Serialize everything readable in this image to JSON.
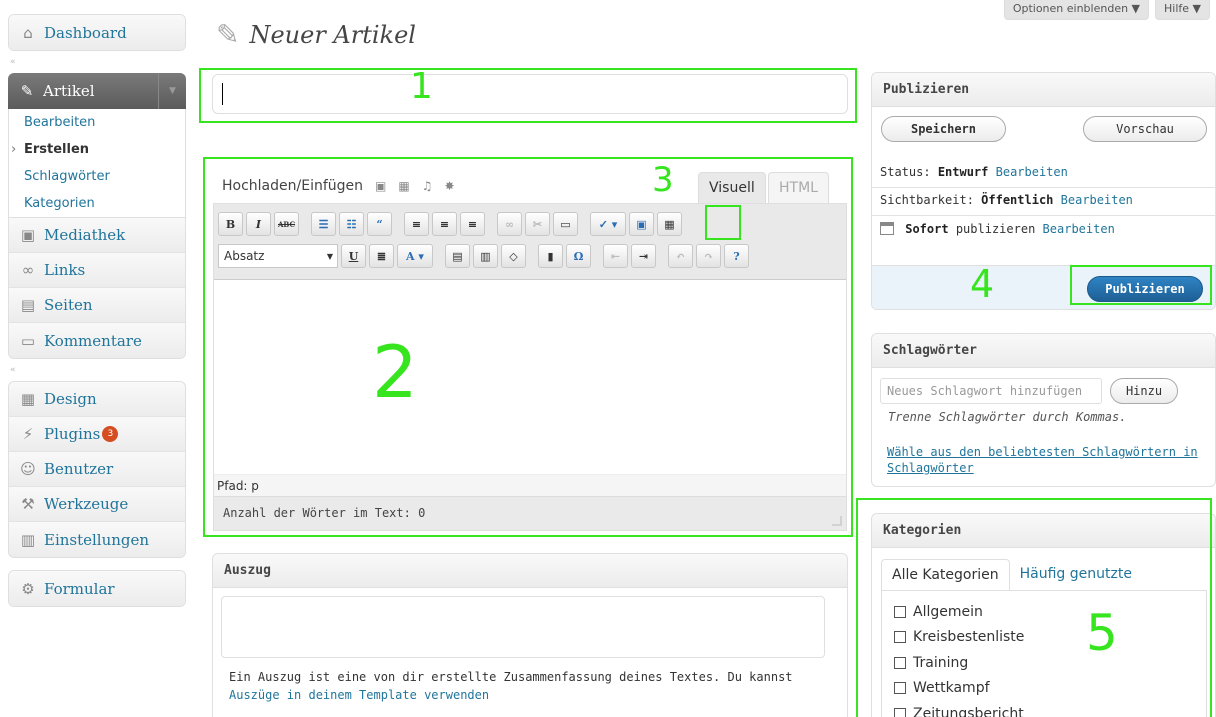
{
  "top_tabs": [
    "Optionen einblenden ▼",
    "Hilfe ▼"
  ],
  "page": {
    "title": "Neuer Artikel"
  },
  "sidebar": {
    "dashboard": "Dashboard",
    "artikel": {
      "label": "Artikel",
      "items": [
        "Bearbeiten",
        "Erstellen",
        "Schlagwörter",
        "Kategorien"
      ]
    },
    "group1": [
      "Mediathek",
      "Links",
      "Seiten",
      "Kommentare"
    ],
    "group2": [
      "Design",
      "Plugins",
      "Benutzer",
      "Werkzeuge",
      "Einstellungen"
    ],
    "plugins_badge": "3",
    "formular": "Formular"
  },
  "editor": {
    "upload_label": "Hochladen/Einfügen",
    "tab_visual": "Visuell",
    "tab_html": "HTML",
    "format_select": "Absatz",
    "path": "Pfad: p",
    "wordcount": "Anzahl der Wörter im Text: 0"
  },
  "excerpt": {
    "title": "Auszug",
    "description": "Ein Auszug ist eine von dir erstellte Zusammenfassung deines Textes. Du kannst",
    "link": "Auszüge in deinem Template verwenden"
  },
  "publish": {
    "title": "Publizieren",
    "save": "Speichern",
    "preview": "Vorschau",
    "status_label": "Status:",
    "status_value": "Entwurf",
    "visibility_label": "Sichtbarkeit:",
    "visibility_value": "Öffentlich",
    "edit": "Bearbeiten",
    "schedule_value": "Sofort",
    "schedule_label": "publizieren",
    "publish_button": "Publizieren"
  },
  "tags": {
    "title": "Schlagwörter",
    "placeholder": "Neues Schlagwort hinzufügen",
    "add": "Hinzu",
    "hint": "Trenne Schlagwörter durch Kommas.",
    "popular_link": "Wähle aus den beliebtesten Schlagwörtern in Schlagwörter"
  },
  "categories": {
    "title": "Kategorien",
    "tab_all": "Alle Kategorien",
    "tab_popular": "Häufig genutzte",
    "items": [
      "Allgemein",
      "Kreisbestenliste",
      "Training",
      "Wettkampf",
      "Zeitungsbericht"
    ]
  },
  "annotations": [
    "1",
    "2",
    "3",
    "4",
    "5"
  ],
  "colors": {
    "annotation": "#37e51f",
    "link": "#21759b",
    "publish": "#21759b"
  }
}
